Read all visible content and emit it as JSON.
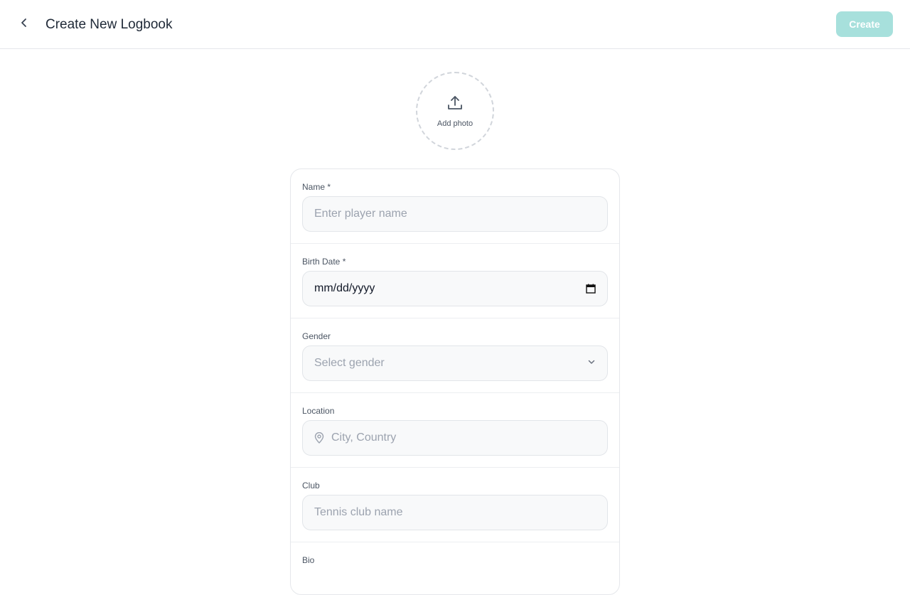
{
  "header": {
    "title": "Create New Logbook",
    "create_label": "Create",
    "icons": {
      "back": "chevron-left-icon"
    }
  },
  "photo": {
    "label": "Add photo",
    "icon": "upload-icon"
  },
  "form": {
    "name": {
      "label": "Name *",
      "placeholder": "Enter player name"
    },
    "birth_date": {
      "label": "Birth Date *",
      "value": "mm/dd/yyyy",
      "icon": "calendar-icon"
    },
    "gender": {
      "label": "Gender",
      "placeholder": "Select gender",
      "icon": "chevron-down-icon"
    },
    "location": {
      "label": "Location",
      "placeholder": "City, Country",
      "icon": "map-pin-icon"
    },
    "club": {
      "label": "Club",
      "placeholder": "Tennis club name"
    },
    "bio": {
      "label": "Bio"
    }
  },
  "colors": {
    "accent_disabled": "#a7e0dc",
    "input_bg": "#f8f9fa",
    "border": "#e5e7eb"
  }
}
